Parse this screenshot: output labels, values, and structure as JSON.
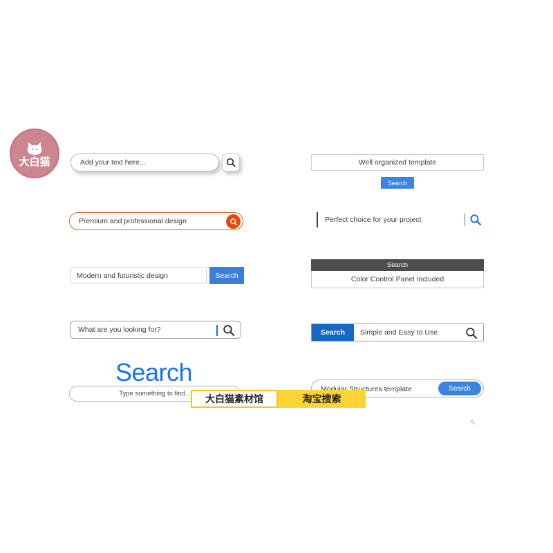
{
  "logo": {
    "icon": "cat-face-icon",
    "text": "大白猫",
    "color": "#cd8690"
  },
  "colors": {
    "blue_primary": "#3b84e0",
    "blue_dark": "#1668c4",
    "blue_heading": "#1a73e8",
    "orange": "#e8470a",
    "dark_panel": "#4d4d4d",
    "watermark_yellow": "#fcd434"
  },
  "left_column": [
    {
      "id": "pill-with-detached-button",
      "placeholder": "Add your text here...",
      "button_icon": "search-icon"
    },
    {
      "id": "orange-pill",
      "placeholder": "Premium and professional design",
      "button_icon": "search-icon"
    },
    {
      "id": "rect-with-blue-button",
      "placeholder": "Modern and futuristic design",
      "button_label": "Search"
    },
    {
      "id": "rounded-with-divider-icon",
      "placeholder": "What are you looking for?",
      "button_icon": "search-icon"
    },
    {
      "id": "heading-above-pill",
      "heading": "Search",
      "placeholder": "Type something to find..."
    }
  ],
  "right_column": [
    {
      "id": "rect-with-button-below",
      "placeholder": "Well organized template",
      "button_label": "Search"
    },
    {
      "id": "borderless-with-blue-icon",
      "placeholder": "Perfect choice for your project",
      "button_icon": "search-icon"
    },
    {
      "id": "dark-header-panel",
      "header": "Search",
      "placeholder": "Color Control Panel Included"
    },
    {
      "id": "button-left-icon-right",
      "button_label": "Search",
      "placeholder": "Simple and Easy to Use",
      "button_icon": "search-icon"
    },
    {
      "id": "pill-with-inner-button",
      "placeholder": "Modular Structures template",
      "button_label": "Search"
    }
  ],
  "watermarks": {
    "left": "大白猫素材馆",
    "right": "淘宝搜索"
  }
}
